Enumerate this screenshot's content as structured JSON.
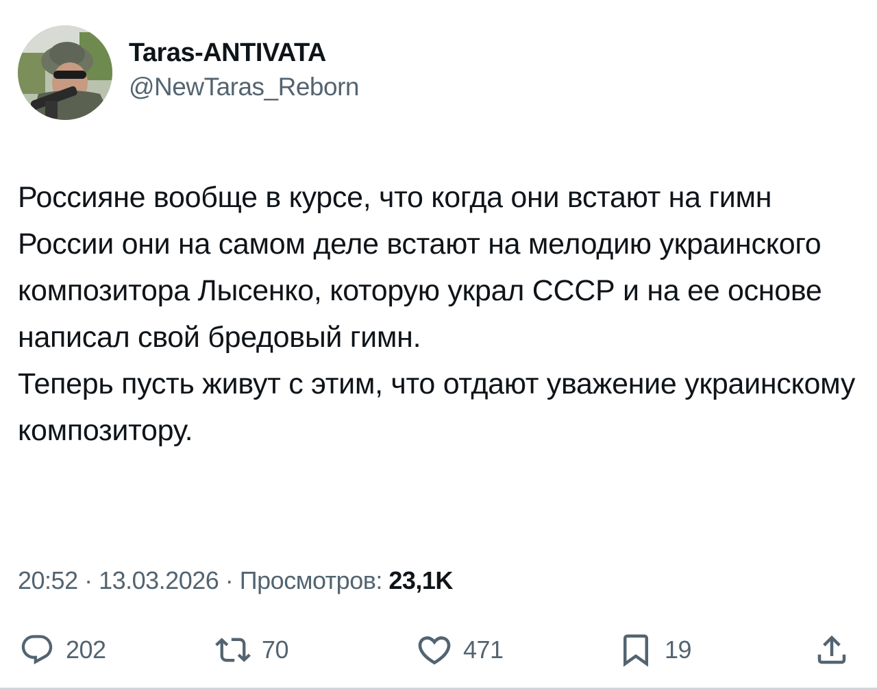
{
  "author": {
    "display_name": "Taras-ANTIVATA",
    "handle": "@NewTaras_Reborn"
  },
  "tweet": {
    "paragraphs": [
      "Россияне вообще в курсе, что когда они встают на гимн России они на самом деле встают на мелодию украинского композитора Лысенко, которую украл СССР и на ее основе написал свой бредовый гимн.",
      "Теперь пусть живут с этим, что отдают уважение украинскому композитору."
    ]
  },
  "meta": {
    "time": "20:52",
    "separator": " · ",
    "date": "13.03.2026",
    "views_label": "Просмотров:",
    "views_count": "23,1K"
  },
  "actions": {
    "replies": {
      "icon": "reply-icon",
      "count": "202"
    },
    "reposts": {
      "icon": "repost-icon",
      "count": "70"
    },
    "likes": {
      "icon": "heart-icon",
      "count": "471"
    },
    "bookmarks": {
      "icon": "bookmark-icon",
      "count": "19"
    },
    "share": {
      "icon": "share-icon"
    }
  },
  "colors": {
    "text_primary": "#0f1419",
    "text_secondary": "#536471"
  }
}
